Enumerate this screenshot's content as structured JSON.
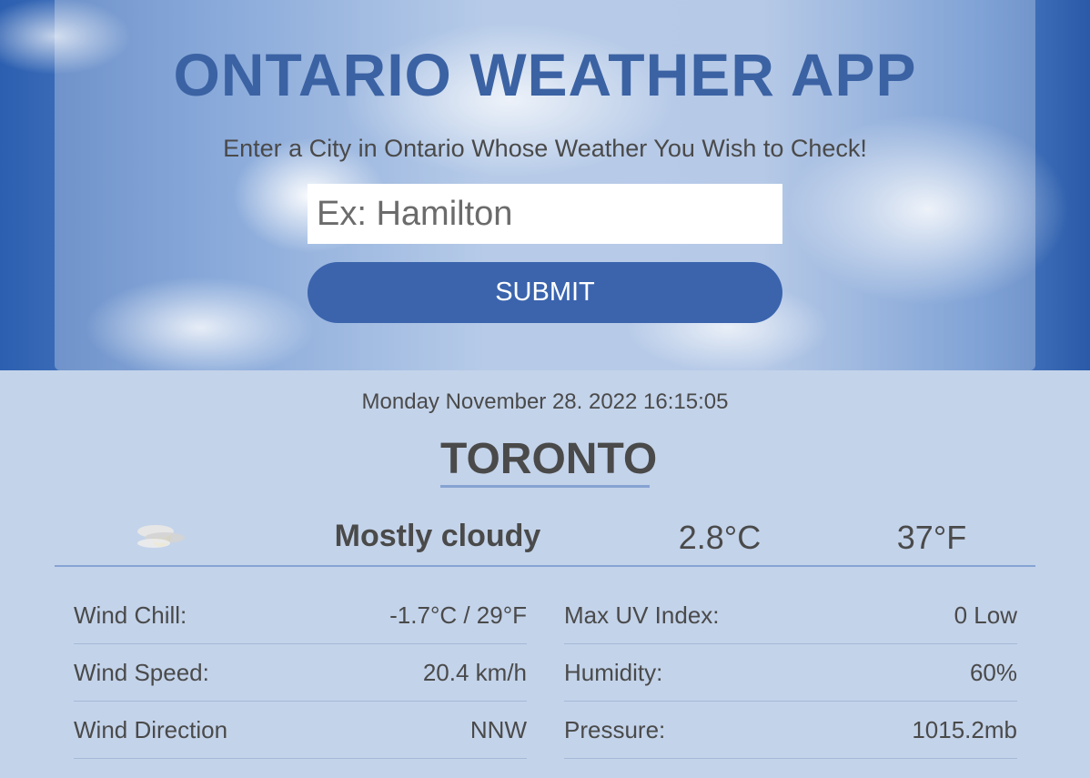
{
  "header": {
    "title": "ONTARIO WEATHER APP",
    "subtitle": "Enter a City in Ontario Whose Weather You Wish to Check!",
    "search_placeholder": "Ex: Hamilton",
    "search_value": "",
    "submit_label": "SUBMIT"
  },
  "current": {
    "datetime": "Monday November 28. 2022 16:15:05",
    "city": "TORONTO",
    "icon": "partly-cloudy-icon",
    "condition": "Mostly cloudy",
    "temp_c": "2.8°C",
    "temp_f": "37°F"
  },
  "details": {
    "left": [
      {
        "label": "Wind Chill:",
        "value": "-1.7°C / 29°F"
      },
      {
        "label": "Wind Speed:",
        "value": "20.4 km/h"
      },
      {
        "label": "Wind Direction",
        "value": "NNW"
      }
    ],
    "right": [
      {
        "label": "Max UV Index:",
        "value": "0 Low"
      },
      {
        "label": "Humidity:",
        "value": "60%"
      },
      {
        "label": "Pressure:",
        "value": "1015.2mb"
      }
    ]
  },
  "colors": {
    "accent": "#3b64ad",
    "title": "#3b62a3",
    "background": "#c3d3ea",
    "divider": "#86a3d3"
  }
}
